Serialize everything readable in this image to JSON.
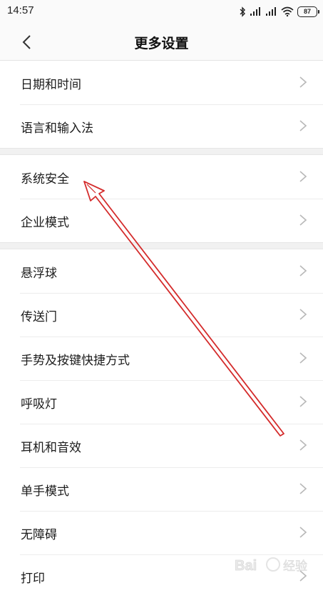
{
  "status_bar": {
    "time": "14:57",
    "battery": "87",
    "icons": [
      "bluetooth-icon",
      "signal-icon",
      "signal-icon",
      "wifi-icon",
      "battery-icon"
    ]
  },
  "header": {
    "title": "更多设置",
    "back_icon": "chevron-left-icon"
  },
  "groups": [
    {
      "items": [
        {
          "label": "日期和时间"
        },
        {
          "label": "语言和输入法"
        }
      ]
    },
    {
      "items": [
        {
          "label": "系统安全"
        },
        {
          "label": "企业模式"
        }
      ]
    },
    {
      "items": [
        {
          "label": "悬浮球"
        },
        {
          "label": "传送门"
        },
        {
          "label": "手势及按键快捷方式"
        },
        {
          "label": "呼吸灯"
        },
        {
          "label": "耳机和音效"
        },
        {
          "label": "单手模式"
        },
        {
          "label": "无障碍"
        },
        {
          "label": "打印"
        }
      ]
    }
  ],
  "annotation": {
    "type": "arrow",
    "color": "#d42b2b",
    "points_to": "系统安全"
  },
  "watermark": {
    "text": "Baidu 经验"
  }
}
